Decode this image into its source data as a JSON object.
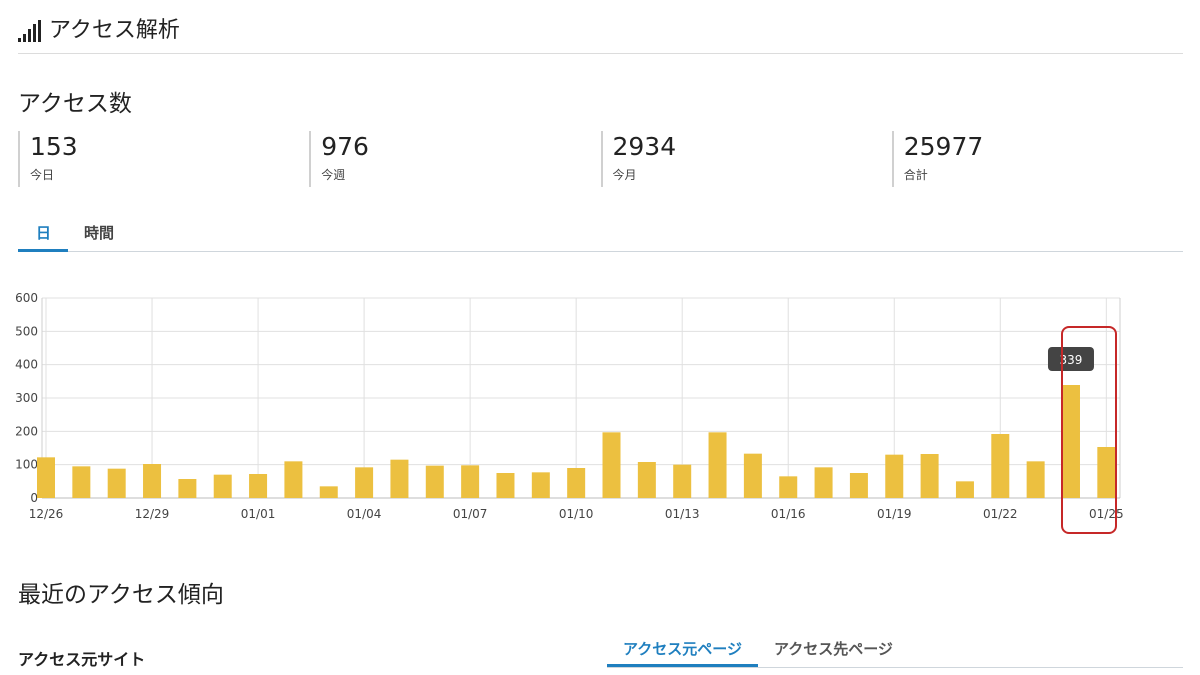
{
  "header": {
    "title": "アクセス解析",
    "icon": "signal-bars-icon"
  },
  "access_count": {
    "title": "アクセス数",
    "stats": [
      {
        "value": "153",
        "label": "今日"
      },
      {
        "value": "976",
        "label": "今週"
      },
      {
        "value": "2934",
        "label": "今月"
      },
      {
        "value": "25977",
        "label": "合計"
      }
    ]
  },
  "period_tabs": {
    "items": [
      "日",
      "時間"
    ],
    "active": "日"
  },
  "trend": {
    "title": "最近のアクセス傾向"
  },
  "referrer": {
    "title": "アクセス元サイト",
    "tabs": [
      "アクセス元ページ",
      "アクセス先ページ"
    ],
    "active_tab": "アクセス元ページ"
  },
  "colors": {
    "bar": "#ecc040",
    "accent": "#1f7fbf",
    "highlight": "#c62828",
    "tooltip": "#444444"
  },
  "chart_data": {
    "type": "bar",
    "categories": [
      "12/26",
      "12/27",
      "12/28",
      "12/29",
      "12/30",
      "12/31",
      "01/01",
      "01/02",
      "01/03",
      "01/04",
      "01/05",
      "01/06",
      "01/07",
      "01/08",
      "01/09",
      "01/10",
      "01/11",
      "01/12",
      "01/13",
      "01/14",
      "01/15",
      "01/16",
      "01/17",
      "01/18",
      "01/19",
      "01/20",
      "01/21",
      "01/22",
      "01/23",
      "01/24",
      "01/25"
    ],
    "tick_labels": [
      "12/26",
      "12/29",
      "01/01",
      "01/04",
      "01/07",
      "01/10",
      "01/13",
      "01/16",
      "01/19",
      "01/22",
      "01/25"
    ],
    "values": [
      122,
      95,
      88,
      102,
      57,
      70,
      72,
      110,
      35,
      92,
      115,
      97,
      98,
      75,
      77,
      90,
      197,
      108,
      100,
      197,
      133,
      65,
      92,
      75,
      130,
      132,
      50,
      192,
      110,
      339,
      153
    ],
    "ylim": [
      0,
      600
    ],
    "yticks": [
      0,
      100,
      200,
      300,
      400,
      500,
      600
    ],
    "grid": true,
    "tooltip": {
      "category": "01/24",
      "value": "339"
    }
  }
}
